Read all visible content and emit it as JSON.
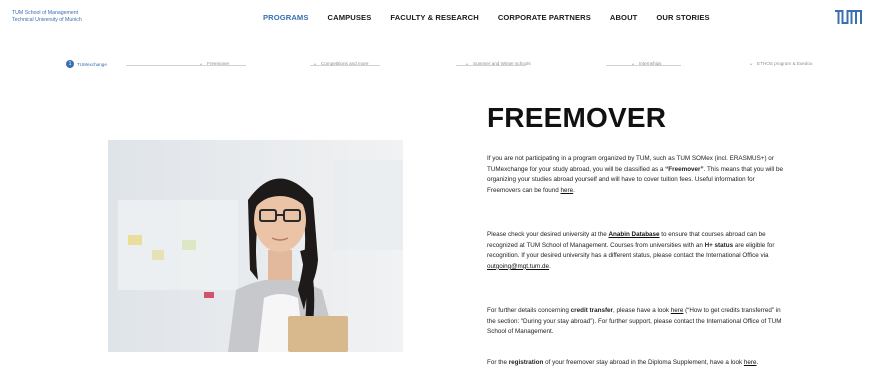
{
  "brand": {
    "line1": "TUM School of Management",
    "line2": "Technical University of Munich"
  },
  "nav": {
    "items": [
      {
        "label": "PROGRAMS",
        "active": true
      },
      {
        "label": "CAMPUSES",
        "active": false
      },
      {
        "label": "FACULTY & RESEARCH",
        "active": false
      },
      {
        "label": "CORPORATE PARTNERS",
        "active": false
      },
      {
        "label": "ABOUT",
        "active": false
      },
      {
        "label": "OUR STORIES",
        "active": false
      }
    ]
  },
  "logo": {
    "text": "TUM"
  },
  "stepper": {
    "steps": [
      {
        "num": "1",
        "label": "TUMexchange"
      },
      {
        "label": "Freemover"
      },
      {
        "label": "Competitions and more"
      },
      {
        "label": "Summer and Winter schools"
      },
      {
        "label": "Internships"
      },
      {
        "label": "ETHOS program & Exedou"
      }
    ]
  },
  "content": {
    "title": "FREEMOVER",
    "p1": {
      "a": "If you are not participating in a program organized by TUM, such as TUM SOMex (incl. ERASMUS+) or TUMexchange for your study abroad, you will be classified as a ",
      "b": "“Freemover”",
      "c": ". This means that you will be organizing your studies abroad yourself and will have to cover tuition fees. Useful information for Freemovers can be found ",
      "link": "here",
      "d": "."
    },
    "p2": {
      "a": "Please check your desired university at the ",
      "link1": "Anabin Database",
      "b": " to ensure that courses abroad can be recognized at TUM School of Management. Courses from universities with an ",
      "bold": "H+ status",
      "c": " are eligible for recognition. If your desired university has a different status, please contact the International Office via ",
      "link2": "outgoing@mgt.tum.de",
      "d": "."
    },
    "p3": {
      "a": "For further details concerning ",
      "bold": "credit transfer",
      "b": ", please have a look ",
      "link": "here",
      "c": " (“How to get credits transferred” in the section: “During your stay abroad”). For further support, please contact the International Office of TUM School of Management."
    },
    "p4": {
      "a": "For the ",
      "bold": "registration",
      "b": " of your freemover stay abroad in the Diploma Supplement, have a look ",
      "link": "here",
      "c": "."
    }
  },
  "colors": {
    "accent": "#3a6fb0",
    "text": "#111111"
  }
}
